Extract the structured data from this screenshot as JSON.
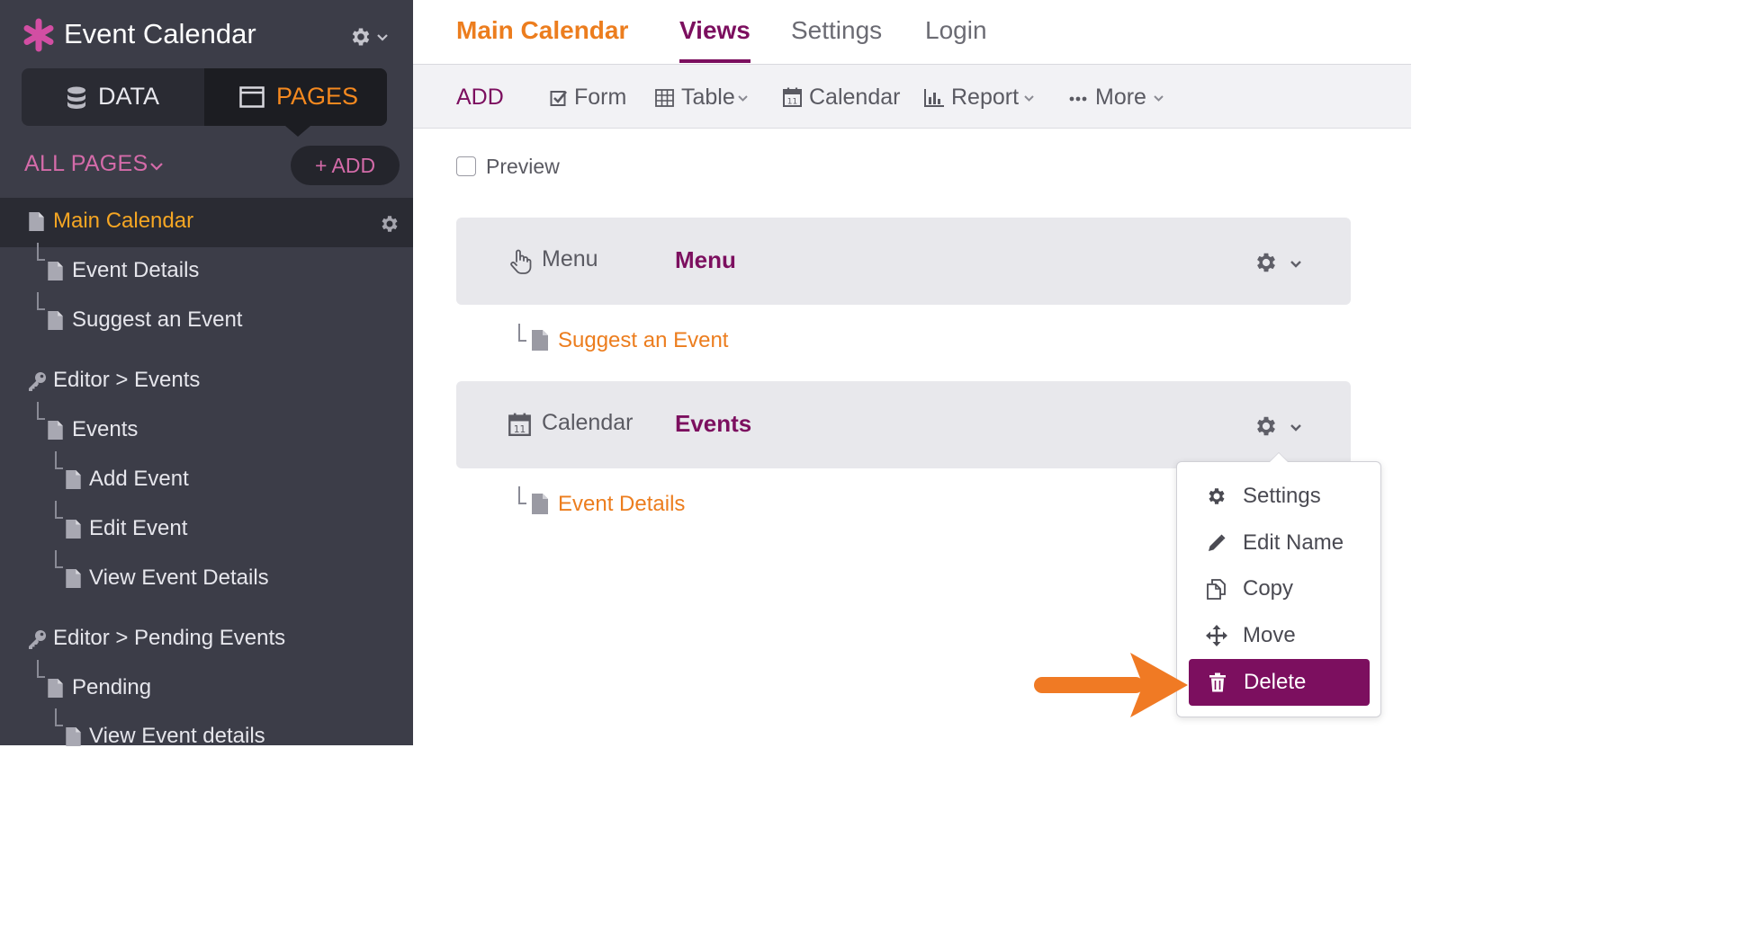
{
  "app": {
    "title": "Event Calendar"
  },
  "sidebar": {
    "segments": [
      {
        "label": "DATA",
        "icon": "database-icon",
        "active": false
      },
      {
        "label": "PAGES",
        "icon": "window-icon",
        "active": true
      }
    ],
    "all_pages_label": "ALL PAGES",
    "add_label": "+ ADD",
    "tree": [
      {
        "label": "Main Calendar",
        "icon": "page-icon",
        "depth": 0,
        "active": true
      },
      {
        "label": "Event Details",
        "icon": "page-icon",
        "depth": 1
      },
      {
        "label": "Suggest an Event",
        "icon": "page-icon",
        "depth": 1
      },
      {
        "label": "Editor > Events",
        "icon": "key-icon",
        "depth": 0
      },
      {
        "label": "Events",
        "icon": "page-icon",
        "depth": 1
      },
      {
        "label": "Add Event",
        "icon": "page-icon",
        "depth": 2
      },
      {
        "label": "Edit Event",
        "icon": "page-icon",
        "depth": 2
      },
      {
        "label": "View Event Details",
        "icon": "page-icon",
        "depth": 2
      },
      {
        "label": "Editor > Pending Events",
        "icon": "key-icon",
        "depth": 0
      },
      {
        "label": "Pending",
        "icon": "page-icon",
        "depth": 1
      },
      {
        "label": "View Event details",
        "icon": "page-icon",
        "depth": 2
      }
    ]
  },
  "topnav": {
    "page_title": "Main Calendar",
    "tabs": [
      {
        "label": "Views",
        "active": true
      },
      {
        "label": "Settings",
        "active": false
      },
      {
        "label": "Login",
        "active": false
      }
    ]
  },
  "toolbar": {
    "add_label": "ADD",
    "items": [
      {
        "label": "Form",
        "icon": "checkbox-icon",
        "dropdown": false
      },
      {
        "label": "Table",
        "icon": "table-icon",
        "dropdown": true
      },
      {
        "label": "Calendar",
        "icon": "calendar-icon",
        "dropdown": false
      },
      {
        "label": "Report",
        "icon": "bar-chart-icon",
        "dropdown": true
      },
      {
        "label": "More",
        "icon": "ellipsis-icon",
        "dropdown": true
      }
    ]
  },
  "preview": {
    "label": "Preview",
    "checked": false
  },
  "views": [
    {
      "type": "Menu",
      "name": "Menu",
      "icon": "hand-pointer-icon",
      "child": "Suggest an Event"
    },
    {
      "type": "Calendar",
      "name": "Events",
      "icon": "calendar-icon",
      "child": "Event Details"
    }
  ],
  "dropdown_menu": {
    "items": [
      {
        "label": "Settings",
        "icon": "gear-icon"
      },
      {
        "label": "Edit Name",
        "icon": "pencil-icon"
      },
      {
        "label": "Copy",
        "icon": "copy-icon"
      },
      {
        "label": "Move",
        "icon": "move-icon"
      },
      {
        "label": "Delete",
        "icon": "trash-icon",
        "highlighted": true
      }
    ]
  },
  "colors": {
    "brand_orange": "#ec7d1e",
    "accent_purple": "#7c0f5f",
    "sidebar_bg": "#3c3d48",
    "sidebar_pink": "#d46ba9",
    "annotation_arrow": "#f07a24"
  }
}
